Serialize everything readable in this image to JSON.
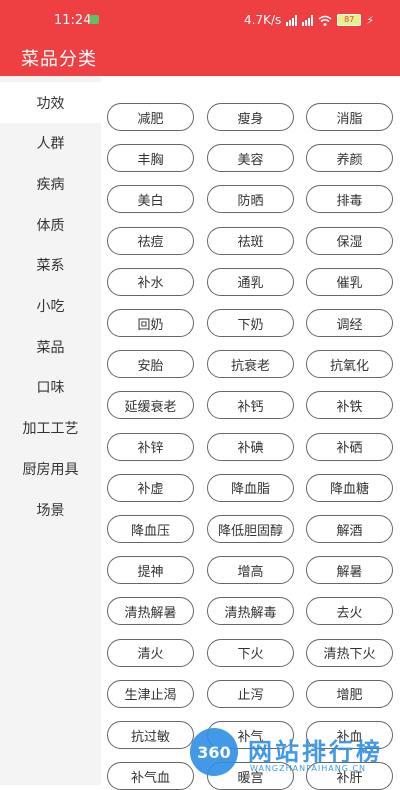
{
  "status_bar": {
    "time": "11:24",
    "net_speed": "4.7K/s",
    "battery": "87"
  },
  "header": {
    "title": "菜品分类"
  },
  "sidebar": {
    "items": [
      {
        "label": "功效",
        "active": true
      },
      {
        "label": "人群"
      },
      {
        "label": "疾病"
      },
      {
        "label": "体质"
      },
      {
        "label": "菜系"
      },
      {
        "label": "小吃"
      },
      {
        "label": "菜品"
      },
      {
        "label": "口味"
      },
      {
        "label": "加工工艺"
      },
      {
        "label": "厨房用具"
      },
      {
        "label": "场景"
      }
    ]
  },
  "tags": [
    "减肥",
    "瘦身",
    "消脂",
    "丰胸",
    "美容",
    "养颜",
    "美白",
    "防晒",
    "排毒",
    "祛痘",
    "祛斑",
    "保湿",
    "补水",
    "通乳",
    "催乳",
    "回奶",
    "下奶",
    "调经",
    "安胎",
    "抗衰老",
    "抗氧化",
    "延缓衰老",
    "补钙",
    "补铁",
    "补锌",
    "补碘",
    "补硒",
    "补虚",
    "降血脂",
    "降血糖",
    "降血压",
    "降低胆固醇",
    "解酒",
    "提神",
    "增高",
    "解暑",
    "清热解暑",
    "清热解毒",
    "去火",
    "清火",
    "下火",
    "清热下火",
    "生津止渴",
    "止泻",
    "增肥",
    "抗过敏",
    "补气",
    "补血",
    "补气血",
    "暖宫",
    "补肝"
  ],
  "watermark": {
    "badge": "360",
    "title": "网站排行榜",
    "subtitle": "WANGZHANPAIHANG.CN"
  },
  "colors": {
    "brand_red": "#ee4043",
    "sidebar_bg": "#f4f4f4",
    "tag_border": "#666666"
  }
}
